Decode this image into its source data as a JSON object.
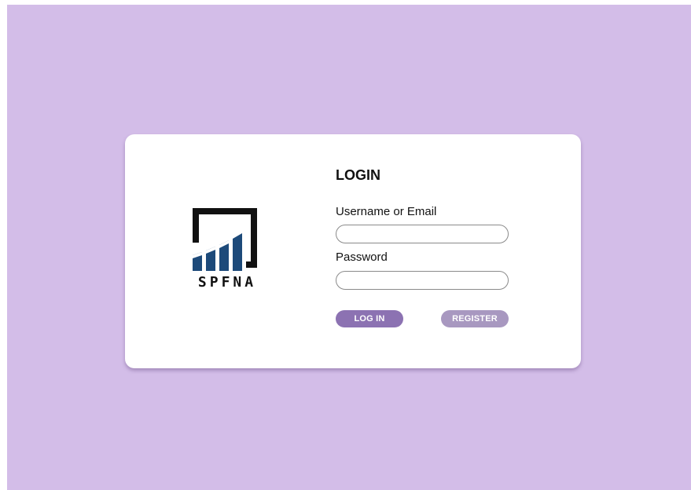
{
  "logo": {
    "text": "SPFNA",
    "icon": "spfna-logo-icon",
    "frame_color": "#111111",
    "bar_color": "#1d4a7a"
  },
  "form": {
    "title": "LOGIN",
    "username_label": "Username or Email",
    "username_value": "",
    "password_label": "Password",
    "password_value": "",
    "login_button": "LOG IN",
    "register_button": "REGISTER"
  },
  "colors": {
    "background": "#d3bde8",
    "card": "#ffffff",
    "login_button": "#8c72b2",
    "register_button": "#a898c0"
  }
}
